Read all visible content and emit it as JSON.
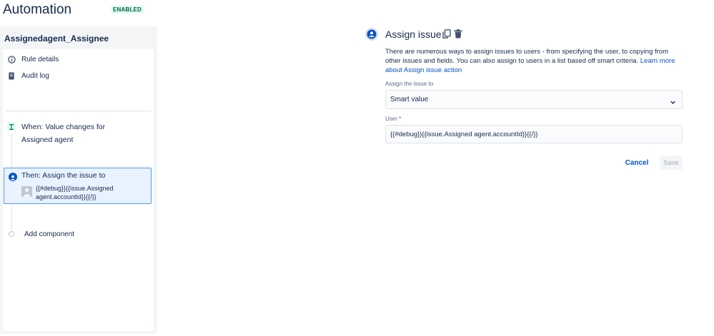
{
  "header": {
    "title": "Automation",
    "status_badge": "ENABLED"
  },
  "sidebar": {
    "rule_name": "Assignedagent_Assignee",
    "nav": [
      {
        "label": "Rule details",
        "icon": "info-icon"
      },
      {
        "label": "Audit log",
        "icon": "audit-log-icon"
      }
    ],
    "trigger": {
      "icon": "trigger-icon",
      "line1": "When: Value changes for",
      "line2": "Assigned agent"
    },
    "action": {
      "icon": "user-circle-icon",
      "title": "Then: Assign the issue to",
      "value_line1": "{{#debug}}{{issue.Assigned",
      "value_line2": "agent.accountId}}{{/}}"
    },
    "add_component_label": "Add component"
  },
  "panel": {
    "title": "Assign issue",
    "icons": [
      "user-circle-icon",
      "copy-icon",
      "delete-icon"
    ],
    "description": "There are numerous ways to assign issues to users - from specifying the user, to copying from other issues and fields. You can also assign to users in a list based off smart criteria.",
    "learn_more_link": "Learn more about Assign issue action",
    "assign_field": {
      "label": "Assign the issue to",
      "selected": "Smart value"
    },
    "user_field": {
      "label": "User",
      "required_marker": "*",
      "value": "{{#debug}}{{issue.Assigned agent.accountId}}{{/}}"
    },
    "buttons": {
      "cancel": "Cancel",
      "save": "Save"
    }
  },
  "colors": {
    "accent": "#0052cc",
    "selected_bg": "#e9f2ff",
    "selected_border": "#4c9aff",
    "enabled_badge_bg": "#e3fcef",
    "enabled_badge_text": "#006644",
    "sidebar_bg": "#f4f5f7"
  }
}
